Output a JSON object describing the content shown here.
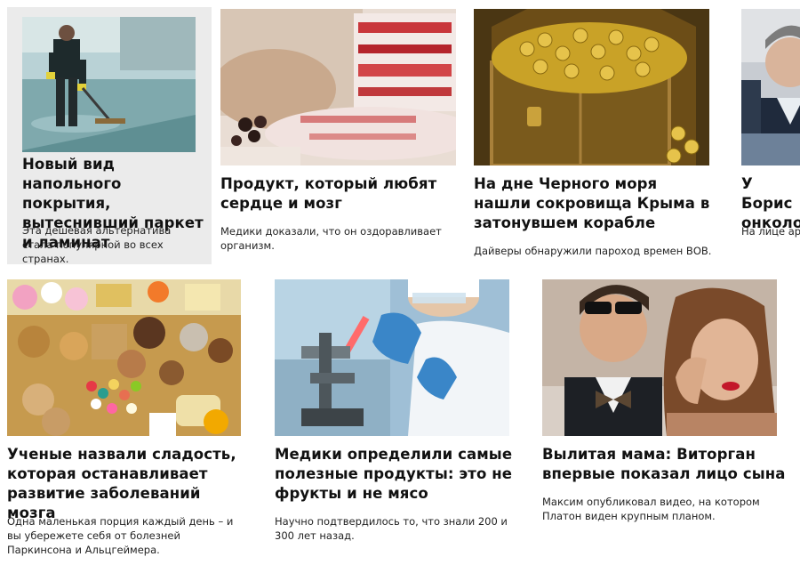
{
  "cards": [
    {
      "title": "Новый вид напольного покрытия, вытеснивший паркет и ламинат",
      "description": "Эта дешевая альтернатива стала популярной во всех странах.",
      "image": "worker-mopping-floor-photo"
    },
    {
      "title": "Продукт, который любят сердце и мозг",
      "description": "Медики доказали, что он оздоравливает организм.",
      "image": "sliced-bacon-photo"
    },
    {
      "title": "На дне Черного моря нашли сокровища Крыма в затонувшем корабле",
      "description": "Дайверы обнаружили пароход времен ВОВ.",
      "image": "gold-coins-chest-photo"
    },
    {
      "title": "У Борис онколо",
      "description": "На лице арт",
      "image": "man-portrait-photo"
    },
    {
      "title": "Ученые назвали сладость, которая останавливает развитие заболеваний мозга",
      "description": "Одна маленькая порция каждый день – и вы убережете себя от болезней Паркинсона и Альцгеймера.",
      "image": "assorted-sweets-photo"
    },
    {
      "title": "Медики определили самые полезные продукты: это не фрукты и не мясо",
      "description": "Научно подтвердилось то, что знали 200 и 300 лет назад.",
      "image": "lab-scientist-microscope-photo"
    },
    {
      "title": "Вылитая мама: Виторган впервые показал лицо сына",
      "description": "Максим опубликовал видео, на котором Платон виден крупным планом.",
      "image": "couple-celebrities-photo"
    }
  ]
}
